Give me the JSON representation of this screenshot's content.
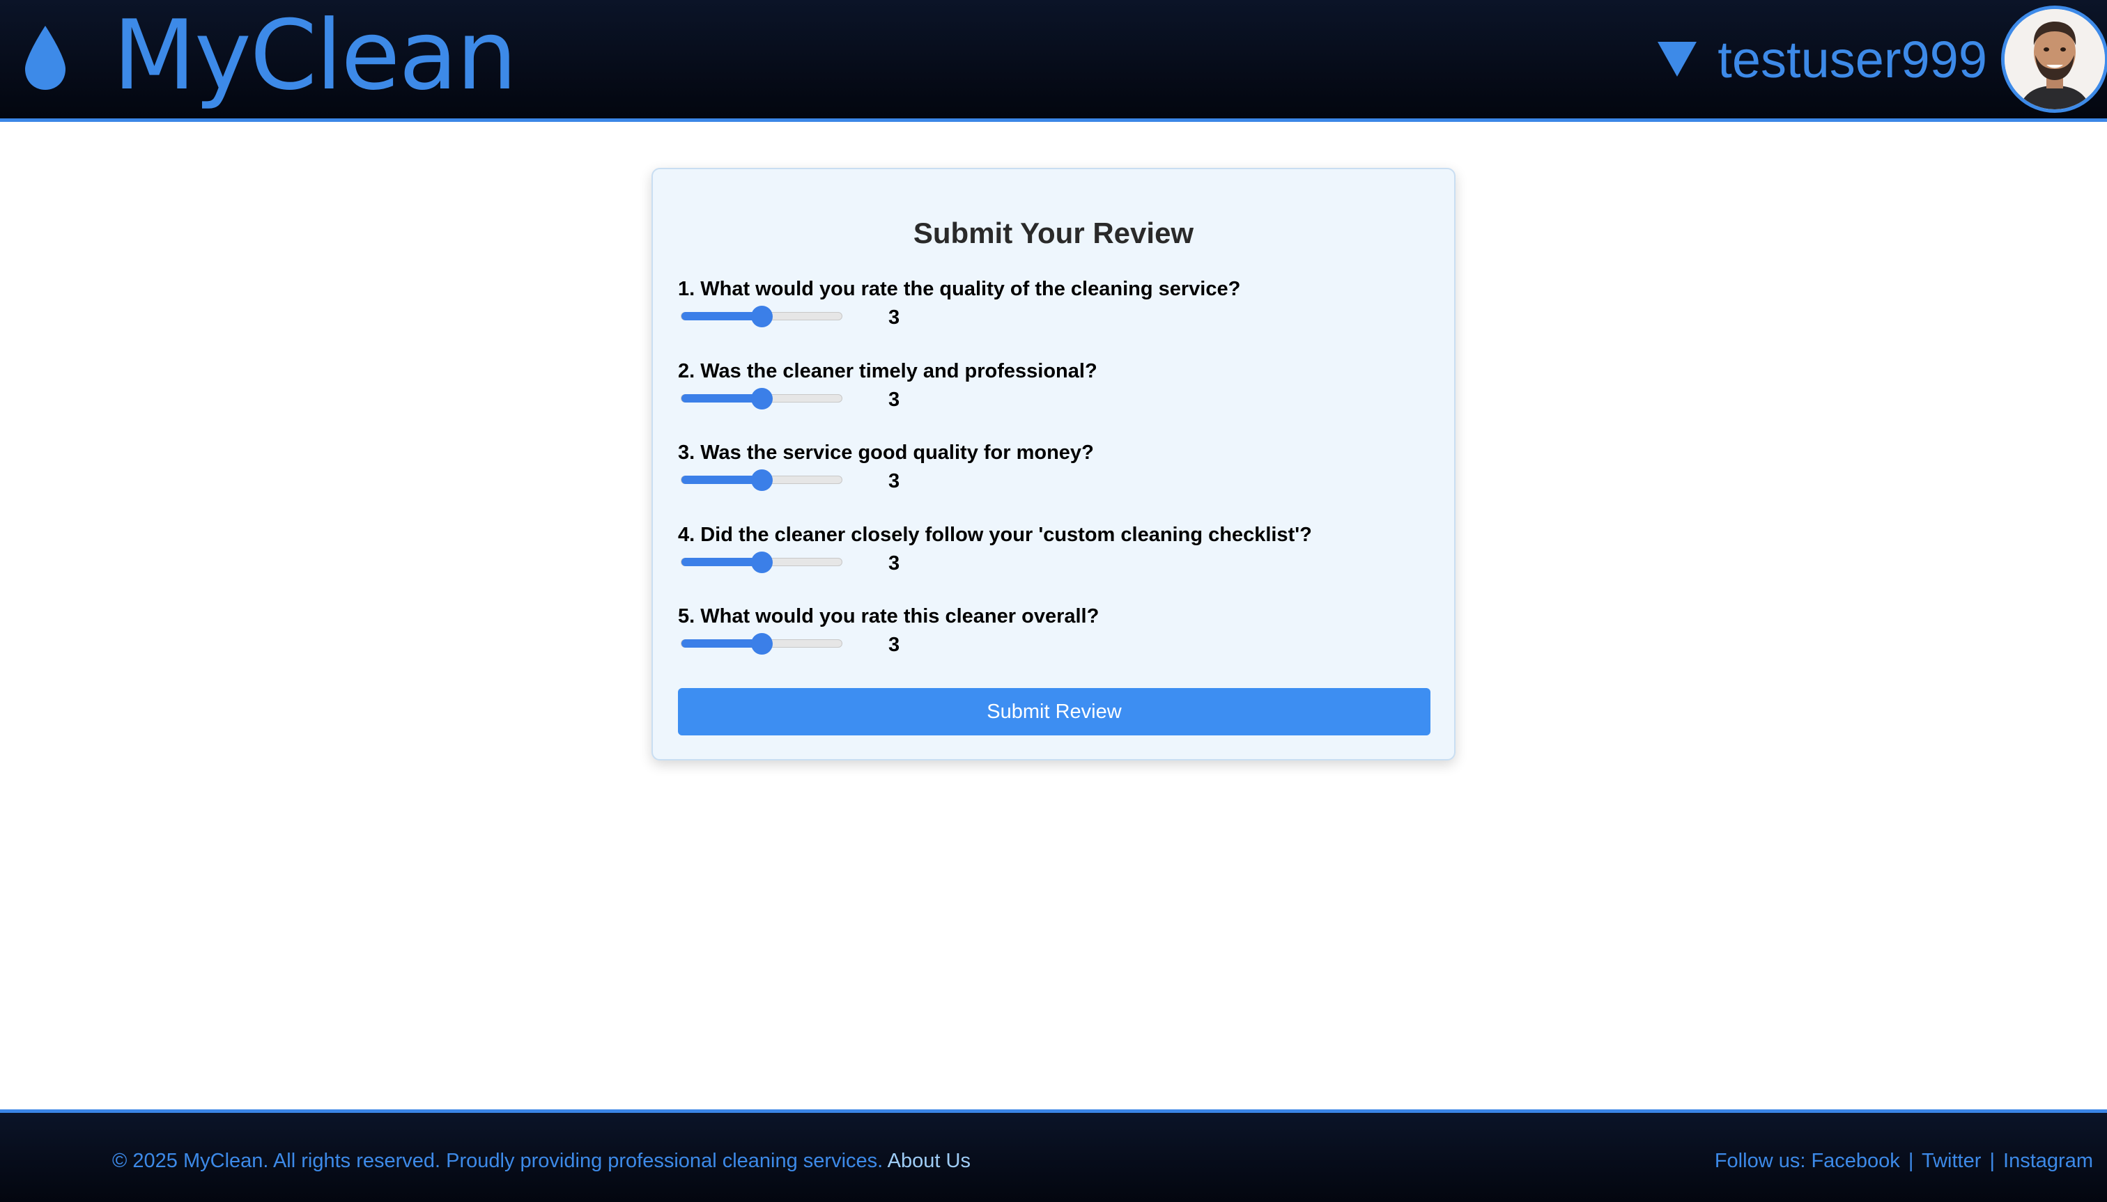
{
  "header": {
    "logo_text": "MyClean",
    "logo_icon": "water-drop-icon",
    "user_menu_icon": "caret-down-icon",
    "username": "testuser999",
    "avatar_icon": "user-avatar"
  },
  "review": {
    "title": "Submit Your Review",
    "questions": [
      {
        "label": "1. What would you rate the quality of the cleaning service?",
        "value": "3",
        "min": 1,
        "max": 5
      },
      {
        "label": "2. Was the cleaner timely and professional?",
        "value": "3",
        "min": 1,
        "max": 5
      },
      {
        "label": "3. Was the service good quality for money?",
        "value": "3",
        "min": 1,
        "max": 5
      },
      {
        "label": "4. Did the cleaner closely follow your 'custom cleaning checklist'?",
        "value": "3",
        "min": 1,
        "max": 5
      },
      {
        "label": "5. What would you rate this cleaner overall?",
        "value": "3",
        "min": 1,
        "max": 5
      }
    ],
    "submit_label": "Submit Review"
  },
  "footer": {
    "copyright": "© 2025 MyClean. All rights reserved. Proudly providing professional cleaning services.",
    "about_label": "About Us",
    "follow_label": "Follow us:",
    "social": {
      "facebook": "Facebook",
      "twitter": "Twitter",
      "instagram": "Instagram"
    },
    "separator": "|"
  },
  "colors": {
    "accent": "#3d8ae8",
    "header_bg": "#03060f",
    "card_bg": "#eef6fd",
    "button_bg": "#3d8ef2"
  }
}
